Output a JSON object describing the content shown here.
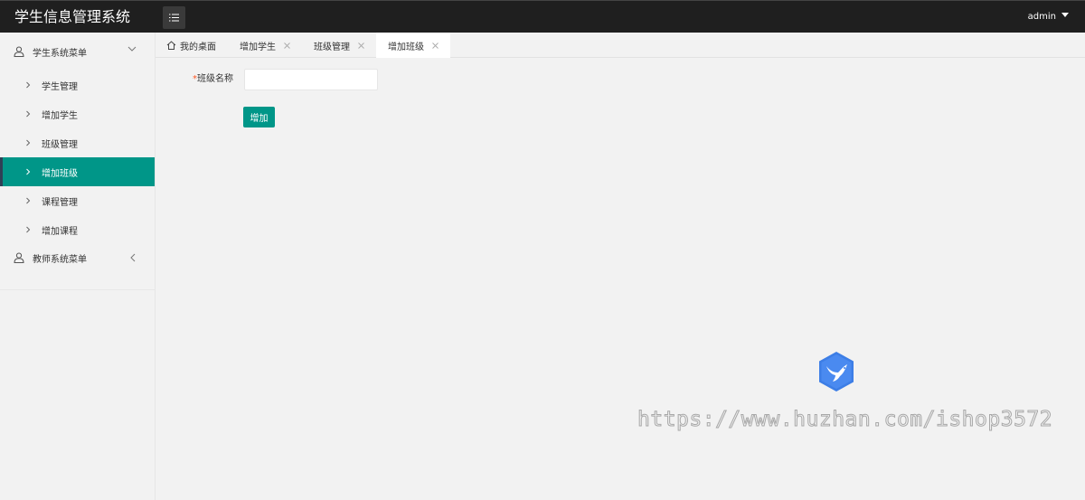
{
  "header": {
    "title": "学生信息管理系统",
    "toggle_icon": "menu-list-icon",
    "user": "admin"
  },
  "sidebar": {
    "groups": [
      {
        "label": "学生系统菜单",
        "icon": "user-icon",
        "expanded": true,
        "items": [
          {
            "label": "学生管理"
          },
          {
            "label": "增加学生"
          },
          {
            "label": "班级管理"
          },
          {
            "label": "增加班级",
            "active": true
          },
          {
            "label": "课程管理"
          },
          {
            "label": "增加课程"
          }
        ]
      },
      {
        "label": "教师系统菜单",
        "icon": "user-icon",
        "expanded": false,
        "items": []
      }
    ]
  },
  "tabs": [
    {
      "label": "我的桌面",
      "icon": "home-icon",
      "closable": false
    },
    {
      "label": "增加学生",
      "closable": true
    },
    {
      "label": "班级管理",
      "closable": true
    },
    {
      "label": "增加班级",
      "closable": true,
      "active": true
    }
  ],
  "form": {
    "required_mark": "*",
    "class_name_label": "班级名称",
    "class_name_value": "",
    "class_name_placeholder": "",
    "submit_label": "增加"
  },
  "watermark": {
    "text": "https://www.huzhan.com/ishop3572"
  },
  "colors": {
    "header_bg": "#1f1f1f",
    "accent": "#009688",
    "page_bg": "#f2f2f2",
    "required": "#ff5722"
  }
}
